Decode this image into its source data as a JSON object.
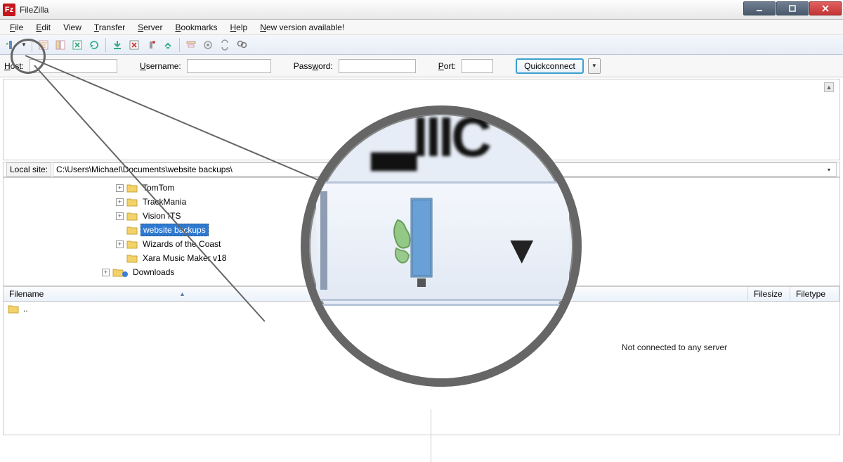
{
  "titlebar": {
    "title": "FileZilla"
  },
  "menu": {
    "file": "File",
    "edit": "Edit",
    "view": "View",
    "transfer": "Transfer",
    "server": "Server",
    "bookmarks": "Bookmarks",
    "help": "Help",
    "new_version": "New version available!"
  },
  "quickconnect": {
    "host_label": "Host:",
    "host_value": "",
    "user_label": "Username:",
    "user_value": "",
    "pass_label": "Password:",
    "pass_value": "",
    "port_label": "Port:",
    "port_value": "",
    "button": "Quickconnect"
  },
  "local": {
    "label": "Local site:",
    "path": "C:\\Users\\Michael\\Documents\\website backups\\"
  },
  "tree": {
    "items": [
      {
        "label": "TomTom",
        "expandable": true
      },
      {
        "label": "TrackMania",
        "expandable": true
      },
      {
        "label": "Vision ITS",
        "expandable": true
      },
      {
        "label": "website backups",
        "expandable": false,
        "selected": true
      },
      {
        "label": "Wizards of the Coast",
        "expandable": true
      },
      {
        "label": "Xara Music Maker v18",
        "expandable": false
      }
    ],
    "parent": {
      "label": "Downloads",
      "expandable": true
    }
  },
  "list": {
    "cols": {
      "filename": "Filename",
      "filesize": "Filesize",
      "filetype": "Filetype"
    },
    "rows": [
      {
        "name": ".."
      }
    ]
  },
  "remote": {
    "message": "Not connected to any server"
  },
  "icons": {
    "site_manager": "site-manager-icon"
  }
}
